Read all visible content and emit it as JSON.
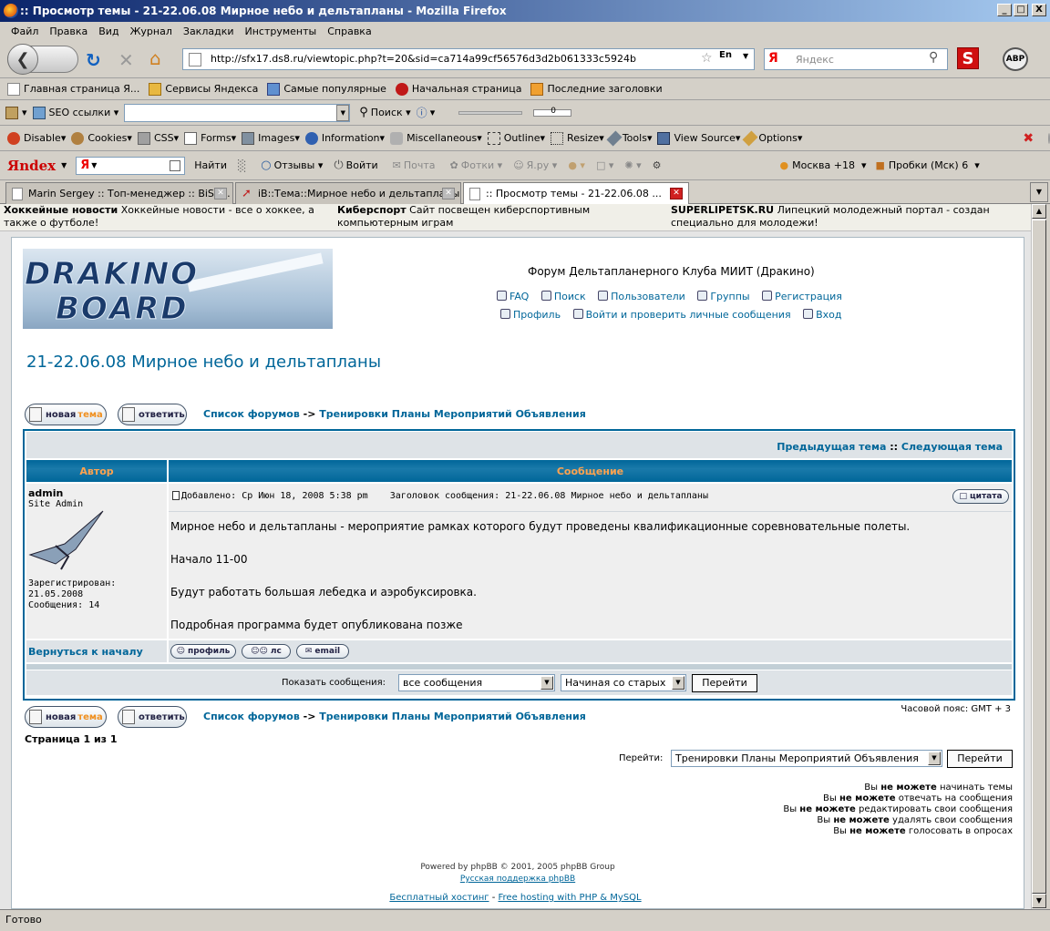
{
  "window": {
    "title": ":: Просмотр темы - 21-22.06.08 Мирное небо и дельтапланы - Mozilla Firefox",
    "min": "_",
    "max": "□",
    "close": "X"
  },
  "menu": [
    "Файл",
    "Правка",
    "Вид",
    "Журнал",
    "Закладки",
    "Инструменты",
    "Справка"
  ],
  "nav": {
    "url": "http://sfx17.ds8.ru/viewtopic.php?t=20&sid=ca714a99cf56576d3d2b061333c5924b",
    "lang": "En",
    "search_placeholder": "Яндекс"
  },
  "bookmarks": [
    "Главная страница Я...",
    "Сервисы Яндекса",
    "Самые популярные",
    "Начальная страница",
    "Последние заголовки"
  ],
  "seo": {
    "label": "SEO ссылки",
    "search": "Поиск",
    "zoom": "0"
  },
  "webdev": [
    "Disable",
    "Cookies",
    "CSS",
    "Forms",
    "Images",
    "Information",
    "Miscellaneous",
    "Outline",
    "Resize",
    "Tools",
    "View Source",
    "Options"
  ],
  "yandex": {
    "logo": "Яndex",
    "find": "Найти",
    "reviews": "Отзывы",
    "login": "Войти",
    "mail": "Почта",
    "photos": "Фотки",
    "yaru": "Я.ру",
    "weather": "Москва +18",
    "traffic": "Пробки (Мск) 6"
  },
  "tabs": [
    {
      "label": "Marin Sergey :: Топ-менеджер :: BiSR..."
    },
    {
      "label": "iB::Тема::Мирное небо и дельтапланы"
    },
    {
      "label": ":: Просмотр темы - 21-22.06.08 ..."
    }
  ],
  "ads": [
    {
      "title": "Хоккейные новости",
      "text": "Хоккейные новости - все о хоккее, а также о футболе!"
    },
    {
      "title": "Киберспорт",
      "text": "Сайт посвещен киберспортивным компьютерным играм"
    },
    {
      "title": "SUPERLIPETSK.RU",
      "text": "Липецкий молодежный портал - создан специально для молодежи!"
    }
  ],
  "forum": {
    "logo_line1": "DRAKINO",
    "logo_line2": "BOARD",
    "site_title": "Форум Дельтапланерного Клуба МИИТ (Дракино)",
    "links_row1": [
      "FAQ",
      "Поиск",
      "Пользователи",
      "Группы",
      "Регистрация"
    ],
    "links_row2": [
      "Профиль",
      "Войти и проверить личные сообщения",
      "Вход"
    ],
    "topic_title": "21-22.06.08 Мирное небо и дельтапланы",
    "btn_new_topic_a": "новая",
    "btn_new_topic_b": "тема",
    "btn_reply": "ответить",
    "breadcrumb_home": "Список форумов",
    "breadcrumb_sep": "->",
    "breadcrumb_forum": "Тренировки Планы Мероприятий Объявления",
    "prev_topic": "Предыдущая тема",
    "sep": "::",
    "next_topic": "Следующая тема",
    "col_author": "Автор",
    "col_message": "Сообщение",
    "post": {
      "author": "admin",
      "rank": "Site Admin",
      "joined": "Зарегистрирован: 21.05.2008",
      "posts": "Сообщения: 14",
      "meta": "Добавлено: Ср Июн 18, 2008 5:38 pm    Заголовок сообщения: 21-22.06.08 Мирное небо и дельтапланы",
      "quote": "цитата",
      "body": [
        "Мирное небо и дельтапланы - мероприятие рамках которого будут проведены квалификационные соревновательные полеты.",
        "Начало 11-00",
        "Будут работать большая лебедка и аэробуксировка.",
        "Подробная программа будет опубликована позже"
      ],
      "back_to_top": "Вернуться к началу",
      "btn_profile": "профиль",
      "btn_pm": "лс",
      "btn_email": "email"
    },
    "show_messages": "Показать сообщения:",
    "filter_all": "все сообщения",
    "filter_order": "Начиная со старых",
    "go": "Перейти",
    "timezone": "Часовой пояс: GMT + 3",
    "page_info": "Страница 1 из 1",
    "jump_label": "Перейти:",
    "jump_value": "Тренировки Планы Мероприятий Объявления",
    "perms": [
      {
        "a": "Вы ",
        "b": "не можете",
        "c": " начинать темы"
      },
      {
        "a": "Вы ",
        "b": "не можете",
        "c": " отвечать на сообщения"
      },
      {
        "a": "Вы ",
        "b": "не можете",
        "c": " редактировать свои сообщения"
      },
      {
        "a": "Вы ",
        "b": "не можете",
        "c": " удалять свои сообщения"
      },
      {
        "a": "Вы ",
        "b": "не можете",
        "c": " голосовать в опросах"
      }
    ],
    "powered": "Powered by phpBB © 2001, 2005 phpBB Group",
    "support": "Русская поддержка phpBB"
  },
  "hosting": {
    "free": "Бесплатный хостинг",
    "dash": "-",
    "php": "Free hosting with PHP & MySQL"
  },
  "status": "Готово"
}
